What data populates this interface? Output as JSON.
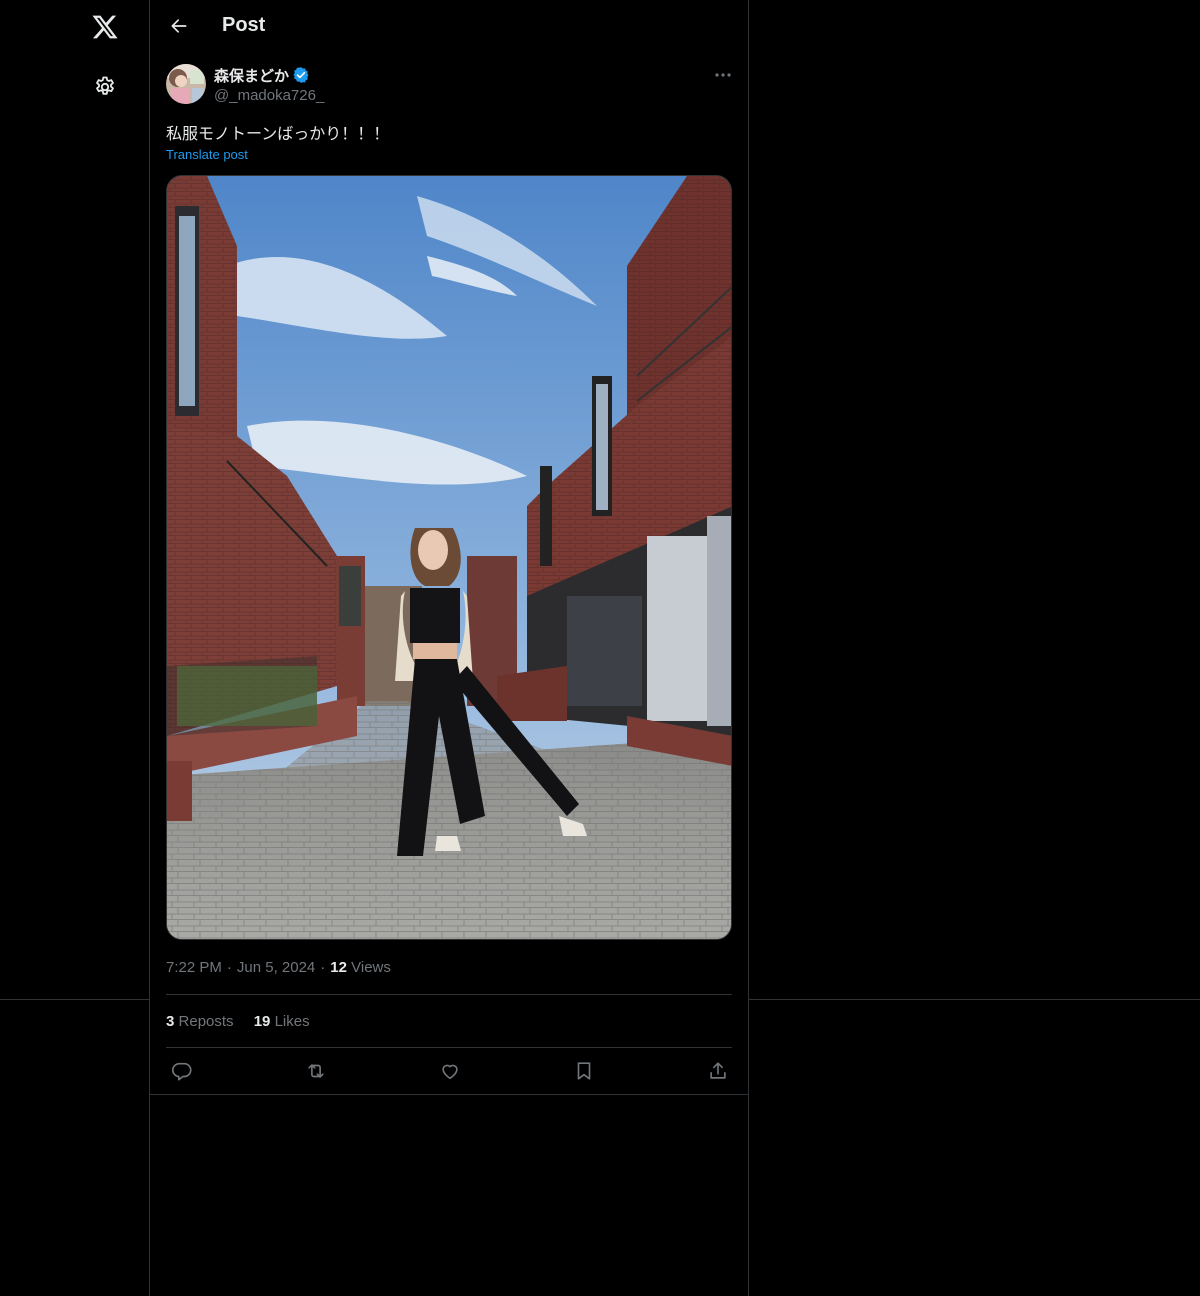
{
  "nav": {
    "logo_icon": "x-logo-icon",
    "settings_icon": "gear-icon"
  },
  "header": {
    "back_icon": "arrow-left-icon",
    "title": "Post"
  },
  "post": {
    "author": {
      "display_name": "森保まどか",
      "handle": "@_madoka726_",
      "verified": true,
      "verified_color": "#1d9bf0"
    },
    "text": "私服モノトーンばっかり！！！",
    "translate_label": "Translate post",
    "media_icon": "photo-street-woman",
    "meta": {
      "time": "7:22 PM",
      "separator": "·",
      "date": "Jun 5, 2024",
      "views_count": "12",
      "views_label": "Views"
    },
    "stats": {
      "reposts_count": "3",
      "reposts_label": "Reposts",
      "likes_count": "19",
      "likes_label": "Likes"
    }
  },
  "actions": [
    {
      "name": "reply",
      "icon": "reply-icon"
    },
    {
      "name": "repost",
      "icon": "repost-icon"
    },
    {
      "name": "like",
      "icon": "heart-icon"
    },
    {
      "name": "bookmark",
      "icon": "bookmark-icon"
    },
    {
      "name": "share",
      "icon": "share-icon"
    }
  ],
  "colors": {
    "background": "#000000",
    "border": "#2f3336",
    "text_primary": "#e7e9ea",
    "text_secondary": "#71767b",
    "accent": "#1d9bf0"
  }
}
